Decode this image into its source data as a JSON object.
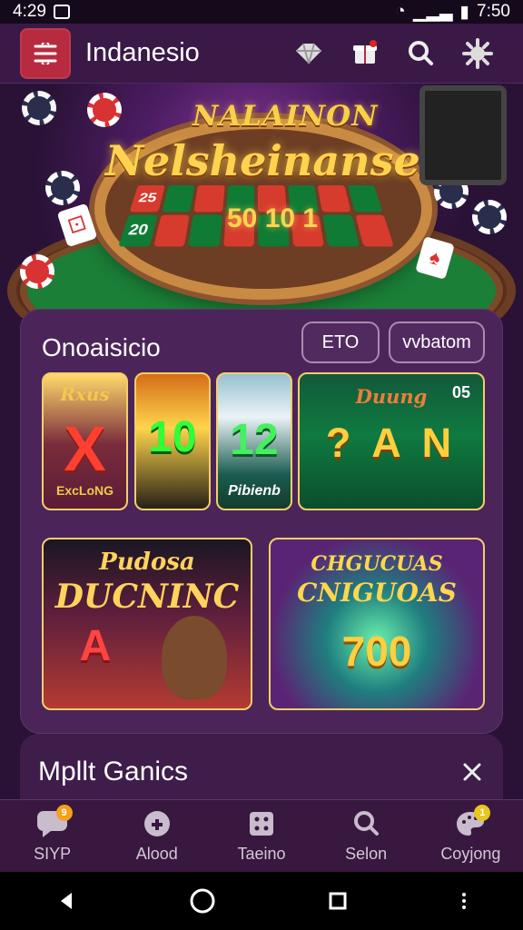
{
  "status": {
    "time": "4:29",
    "right_time": "7:50"
  },
  "header": {
    "title": "Indanesio",
    "accent": "#b82a3f",
    "icons": [
      "diamond-icon",
      "gift-icon",
      "search-icon",
      "gear-icon"
    ]
  },
  "hero": {
    "line1": "NALAINON",
    "line2": "Nelsheinanse",
    "number": "50 10 1",
    "grid": [
      "25",
      "",
      "",
      "",
      "",
      "",
      "",
      "",
      "20",
      "",
      "",
      "",
      "",
      "",
      "",
      ""
    ]
  },
  "section": {
    "title": "Onoaisicio",
    "button1": "ETO",
    "button2": "vvbatom"
  },
  "tiles": [
    {
      "label": "Rxus",
      "big": "X",
      "sub": "ExcLoNG"
    },
    {
      "label": "",
      "big": "10",
      "sub": ""
    },
    {
      "label": "",
      "big": "12",
      "sub": "Pibienb"
    },
    {
      "label": "Duung",
      "big": "? A N",
      "sub": "05"
    },
    {
      "label": "Pudosa",
      "big": "A",
      "sub": "DUCNINC"
    },
    {
      "label": "CNIGUOAS",
      "big": "700",
      "sub": "CHGUCUAS"
    }
  ],
  "promo": {
    "title": "Mpllt Ganics",
    "close": "×"
  },
  "bottom_nav": [
    {
      "label": "SIYP",
      "badge": "9",
      "icon": "chat-icon"
    },
    {
      "label": "Alood",
      "badge": "",
      "icon": "game-icon"
    },
    {
      "label": "Taeino",
      "badge": "",
      "icon": "dice-icon"
    },
    {
      "label": "Selon",
      "badge": "",
      "icon": "search-icon"
    },
    {
      "label": "Coyjong",
      "badge": "1",
      "icon": "palette-icon"
    }
  ]
}
